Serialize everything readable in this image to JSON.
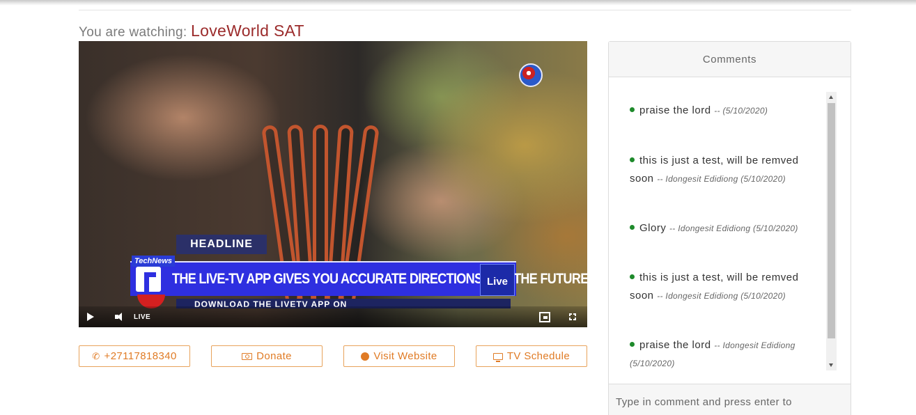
{
  "header": {
    "watching_prefix": "You are watching:",
    "channel_name": "LoveWorld SAT"
  },
  "player": {
    "overlay": {
      "headline_tag": "HEADLINE",
      "technews_label": "TechNews",
      "ticker_text": "THE LIVE-TV APP GIVES YOU ACCURATE DIRECTIONS FOR THE FUTURE.",
      "badge_text": "Live",
      "download_text": "DOWNLOAD THE LIVETV APP ON"
    },
    "controls": {
      "live_label": "LIVE"
    }
  },
  "actions": {
    "phone_label": "+27117818340",
    "donate_label": "Donate",
    "website_label": "Visit Website",
    "schedule_label": "TV Schedule"
  },
  "comments": {
    "title": "Comments",
    "items": [
      {
        "text": "praise the lord",
        "meta": "-- (5/10/2020)"
      },
      {
        "text": "this is just a test, will be remved soon",
        "meta": "-- Idongesit Edidiong (5/10/2020)"
      },
      {
        "text": "Glory",
        "meta": "-- Idongesit Edidiong (5/10/2020)"
      },
      {
        "text": "this is just a test, will be remved soon",
        "meta": "-- Idongesit Edidiong (5/10/2020)"
      },
      {
        "text": "praise the lord",
        "meta": "-- Idongesit Edidiong (5/10/2020)"
      }
    ],
    "input_placeholder": "Type in comment and press enter to"
  },
  "colors": {
    "accent_orange": "#e07b25",
    "channel_red": "#9b2b2b",
    "comment_dot_green": "#1e8a2b",
    "ticker_blue": "#2e2fe0"
  }
}
